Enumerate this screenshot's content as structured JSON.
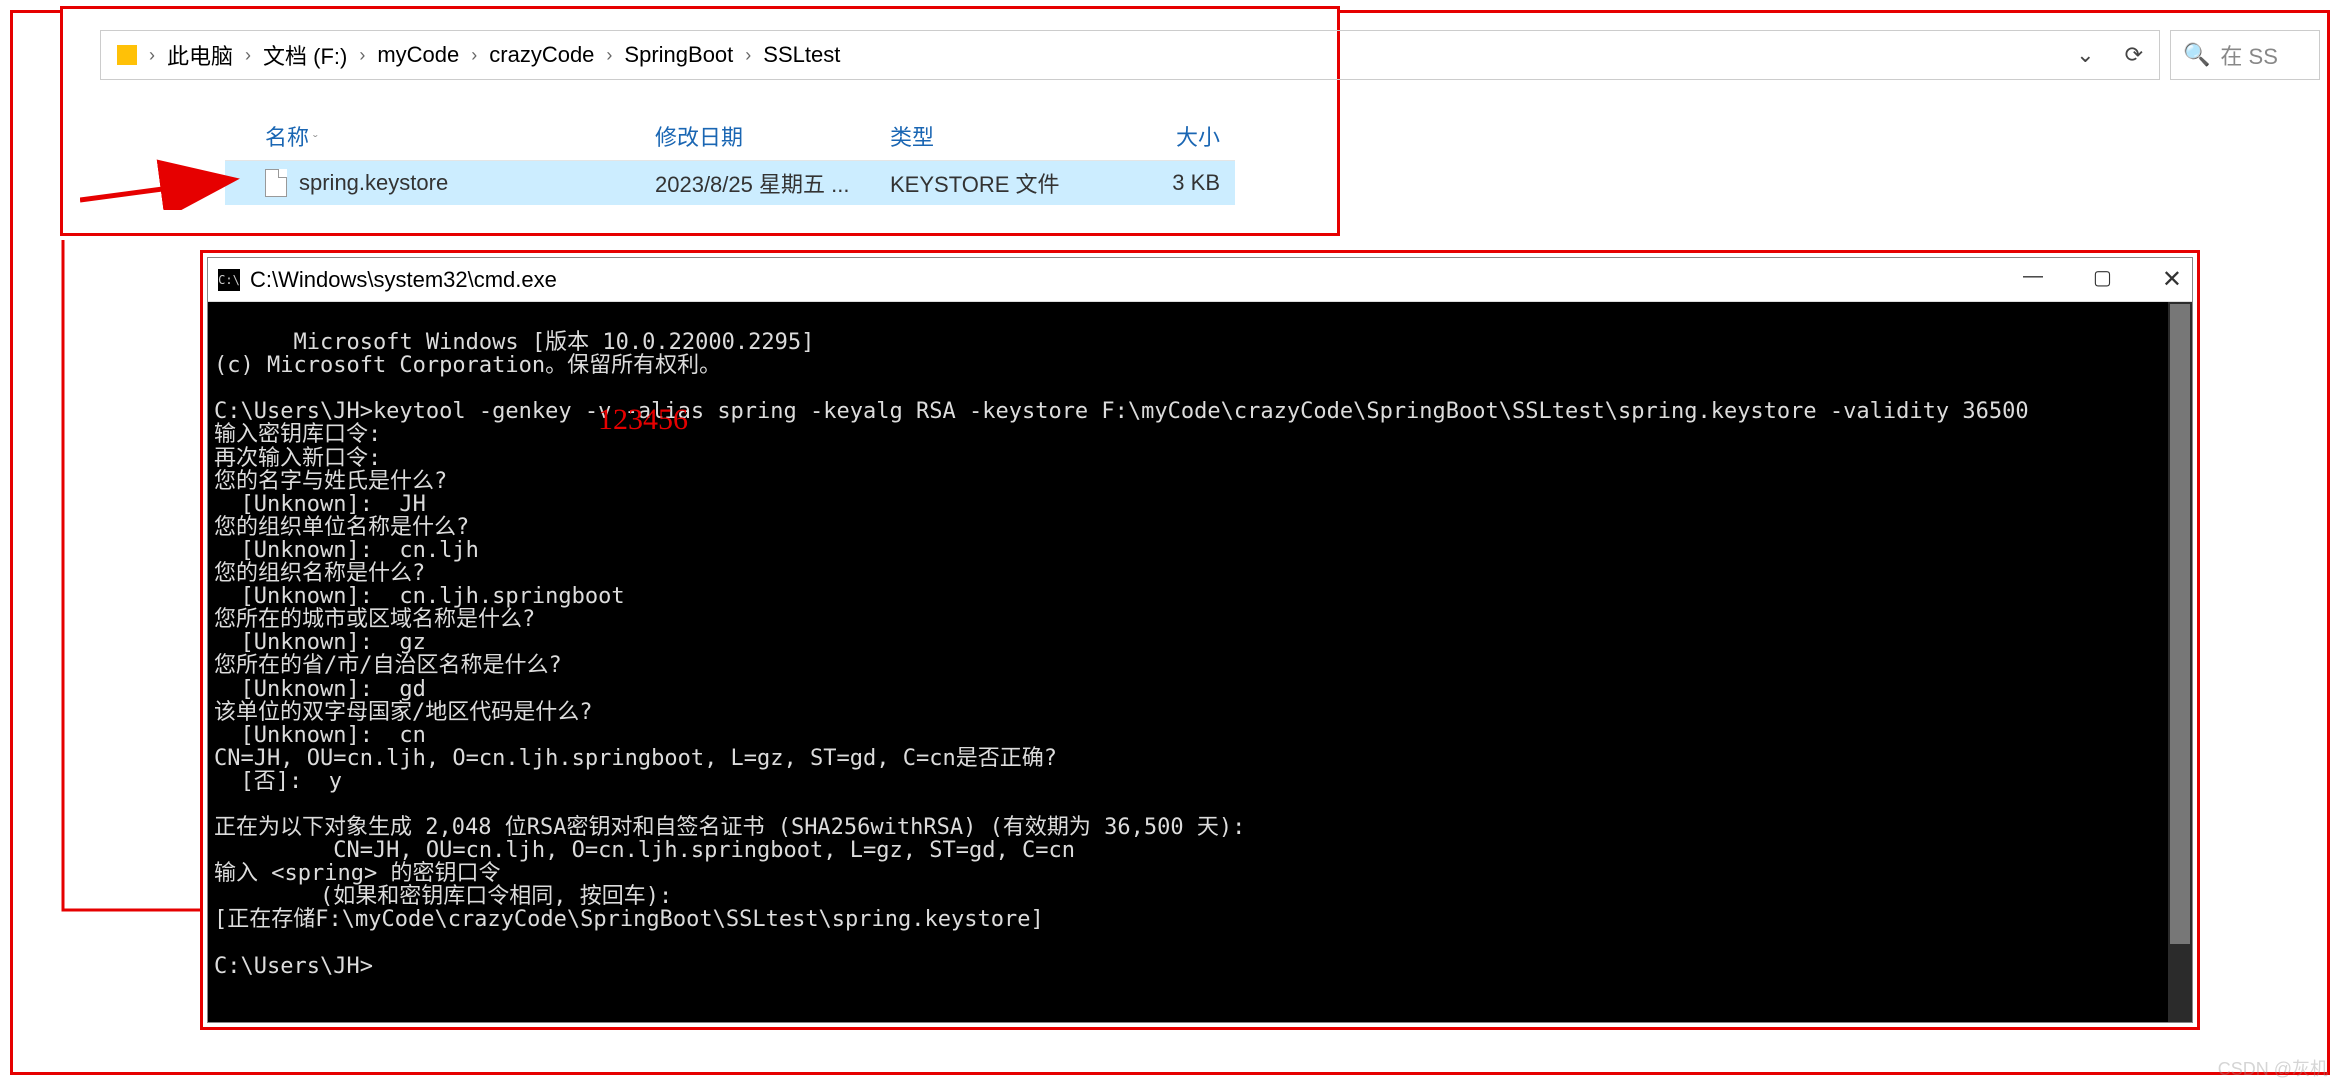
{
  "breadcrumbs": {
    "b0": "此电脑",
    "b1": "文档 (F:)",
    "b2": "myCode",
    "b3": "crazyCode",
    "b4": "SpringBoot",
    "b5": "SSLtest"
  },
  "addr_actions": {
    "dropdown_glyph": "⌄",
    "refresh_glyph": "⟳"
  },
  "search": {
    "icon_glyph": "🔍",
    "placeholder": "在 SS"
  },
  "table": {
    "headers": {
      "name": "名称",
      "modified": "修改日期",
      "type": "类型",
      "size": "大小"
    },
    "row": {
      "name": "spring.keystore",
      "modified": "2023/8/25  星期五 ...",
      "type": "KEYSTORE 文件",
      "size": "3 KB"
    }
  },
  "annotation": {
    "password": "123456"
  },
  "terminal": {
    "title": "C:\\Windows\\system32\\cmd.exe",
    "win": {
      "min": "—",
      "max": "▢",
      "close": "✕"
    },
    "body": "Microsoft Windows [版本 10.0.22000.2295]\n(c) Microsoft Corporation。保留所有权利。\n\nC:\\Users\\JH>keytool -genkey -v -alias spring -keyalg RSA -keystore F:\\myCode\\crazyCode\\SpringBoot\\SSLtest\\spring.keystore -validity 36500\n输入密钥库口令:\n再次输入新口令:\n您的名字与姓氏是什么?\n  [Unknown]:  JH\n您的组织单位名称是什么?\n  [Unknown]:  cn.ljh\n您的组织名称是什么?\n  [Unknown]:  cn.ljh.springboot\n您所在的城市或区域名称是什么?\n  [Unknown]:  gz\n您所在的省/市/自治区名称是什么?\n  [Unknown]:  gd\n该单位的双字母国家/地区代码是什么?\n  [Unknown]:  cn\nCN=JH, OU=cn.ljh, O=cn.ljh.springboot, L=gz, ST=gd, C=cn是否正确?\n  [否]:  y\n\n正在为以下对象生成 2,048 位RSA密钥对和自签名证书 (SHA256withRSA) (有效期为 36,500 天):\n         CN=JH, OU=cn.ljh, O=cn.ljh.springboot, L=gz, ST=gd, C=cn\n输入 <spring> 的密钥口令\n        (如果和密钥库口令相同, 按回车):\n[正在存储F:\\myCode\\crazyCode\\SpringBoot\\SSLtest\\spring.keystore]\n\nC:\\Users\\JH>"
  },
  "watermark": "CSDN @灰机"
}
